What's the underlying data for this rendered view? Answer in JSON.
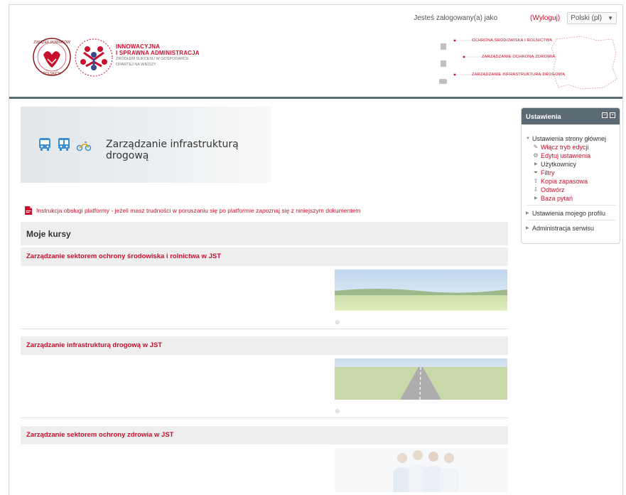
{
  "header": {
    "logged_in_as": "Jesteś zalogowany(a) jako",
    "logout": "(Wyloguj)",
    "language": "Polski (pl)",
    "logo_lines": [
      "INNOWACYJNA",
      "I SPRAWNA ADMINISTRACJA"
    ],
    "logo_subtitle": [
      "ŹRÓDŁEM SUKCESU W GOSPODARCE",
      "OPARTEJ NA WIEDZY"
    ],
    "zp_logo_text": "ZWIĄZEK POWIATÓW POLSKICH",
    "map_items": [
      "OCHRONA ŚRODOWISKA I ROLNICTWA",
      "ZARZĄDZANIE OCHRONĄ ZDROWIA",
      "ZARZĄDZANIE INFRASTRUKTURĄ DROGOWĄ"
    ]
  },
  "banner": {
    "title": "Zarządzanie infrastrukturą drogową"
  },
  "instruction_link": "Instrukcja obsługi platformy - jeżeli masz trudności w poruszaniu się po platformie zapoznaj się z niniejszym dokumentem",
  "my_courses": "Moje kursy",
  "courses": [
    {
      "title": "Zarządzanie sektorem ochrony środowiska i rolnictwa w JST"
    },
    {
      "title": "Zarządzanie infrastrukturą drogową w JST"
    },
    {
      "title": "Zarządzanie sektorem ochrony zdrowia w JST"
    }
  ],
  "settings": {
    "title": "Ustawienia",
    "front_page": "Ustawienia strony głównej",
    "items": [
      "Włącz tryb edycji",
      "Edytuj ustawienia",
      "Użytkownicy",
      "Filtry",
      "Kopia zapasowa",
      "Odtwórz",
      "Baza pytań"
    ],
    "my_profile": "Ustawienia mojego profilu",
    "admin": "Administracja serwisu"
  },
  "colors": {
    "accent": "#c8102e",
    "header_bar": "#5c6b73",
    "rule": "#5a6a72"
  }
}
